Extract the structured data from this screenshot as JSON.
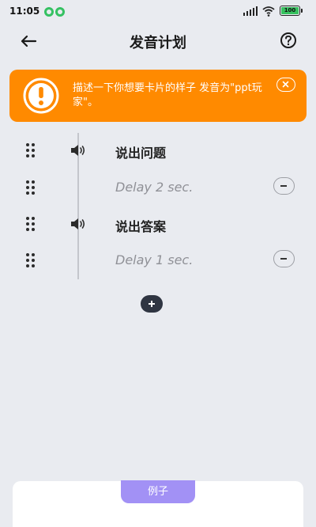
{
  "status_bar": {
    "time": "11:05",
    "battery": "100",
    "accent_color": "#35c162"
  },
  "header": {
    "title": "发音计划",
    "back_icon": "arrow-left-icon",
    "help_icon": "question-circle-icon"
  },
  "alert": {
    "text": "描述一下你想要卡片的样子 发音为\"ppt玩家\"。",
    "background_color": "#ff8a00",
    "icon": "exclamation-circle-icon",
    "close_icon": "close-icon"
  },
  "steps": [
    {
      "type": "speak",
      "label": "说出问题",
      "icon": "speaker-icon"
    },
    {
      "type": "delay",
      "label": "Delay 2 sec."
    },
    {
      "type": "speak",
      "label": "说出答案",
      "icon": "speaker-icon"
    },
    {
      "type": "delay",
      "label": "Delay 1 sec."
    }
  ],
  "example": {
    "tab_label": "例子",
    "tab_color": "#a291f5"
  }
}
